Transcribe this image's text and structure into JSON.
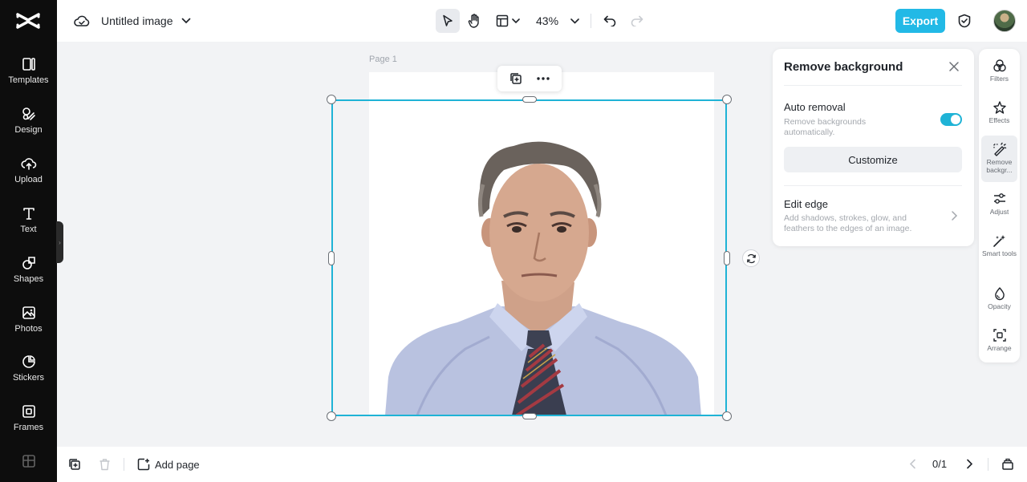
{
  "left_nav": {
    "items": [
      {
        "label": "Templates",
        "icon": "templates-icon"
      },
      {
        "label": "Design",
        "icon": "design-icon"
      },
      {
        "label": "Upload",
        "icon": "upload-icon"
      },
      {
        "label": "Text",
        "icon": "text-icon"
      },
      {
        "label": "Shapes",
        "icon": "shapes-icon"
      },
      {
        "label": "Photos",
        "icon": "photos-icon"
      },
      {
        "label": "Stickers",
        "icon": "stickers-icon"
      },
      {
        "label": "Frames",
        "icon": "frames-icon"
      }
    ]
  },
  "header": {
    "doc_title": "Untitled image",
    "zoom": "43%",
    "export_label": "Export"
  },
  "canvas": {
    "page_label": "Page 1"
  },
  "remove_bg_panel": {
    "title": "Remove background",
    "auto_removal": {
      "title": "Auto removal",
      "desc_line1": "Remove backgrounds",
      "desc_line2": "automatically.",
      "enabled": true
    },
    "customize_label": "Customize",
    "edit_edge": {
      "title": "Edit edge",
      "desc_line1": "Add shadows, strokes, glow, and",
      "desc_line2": "feathers to the edges of an image."
    }
  },
  "right_tools": {
    "items": [
      {
        "label": "Filters",
        "icon": "filters-icon"
      },
      {
        "label": "Effects",
        "icon": "effects-icon"
      },
      {
        "label": "Remove backgr...",
        "icon": "remove-background-icon",
        "active": true
      },
      {
        "label": "Adjust",
        "icon": "adjust-icon"
      },
      {
        "label": "Smart tools",
        "icon": "smart-tools-icon"
      },
      {
        "label": "Opacity",
        "icon": "opacity-icon"
      },
      {
        "label": "Arrange",
        "icon": "arrange-icon"
      }
    ]
  },
  "footer": {
    "add_page_label": "Add page",
    "page_counter": "0/1"
  },
  "colors": {
    "accent": "#1fb3d6",
    "export": "#22b9e6",
    "sidebar": "#0d0d0d"
  }
}
